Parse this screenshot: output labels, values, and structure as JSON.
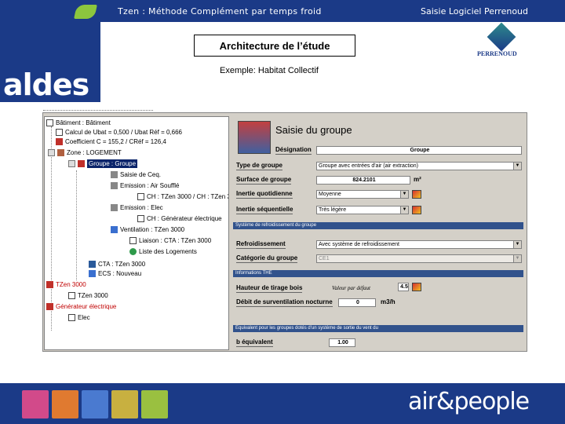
{
  "header": {
    "subtitle": "Tzen : Méthode Complément par temps froid",
    "right_title": "Saisie Logiciel Perrenoud",
    "slide_title": "Architecture de l’étude",
    "example": "Exemple: Habitat Collectif"
  },
  "brand": {
    "left_logo": "aldes",
    "right_logo_name": "PERRENOUD",
    "tagline": "air&people",
    "colors": {
      "navy": "#1b3a87",
      "green": "#8cc63e",
      "window_grey": "#d4d0c8",
      "section_blue": "#31528c"
    }
  },
  "tree": {
    "items": [
      {
        "label": "Bâtiment : Bâtiment",
        "icon": "document-icon"
      },
      {
        "label": "Calcul de Ubat = 0,500 / Ubat Réf = 0,666",
        "icon": "document-icon"
      },
      {
        "label": "Coefficient C = 155,2 / CRéf = 126,4",
        "icon": "c-icon"
      },
      {
        "label": "Zone : LOGEMENT",
        "icon": "house-icon"
      },
      {
        "label": "Groupe : Groupe",
        "icon": "group-icon",
        "selected": true
      },
      {
        "label": "Saisie de Ceq.",
        "icon": "grey-icon"
      },
      {
        "label": "Emission : Air Soufflé",
        "icon": "grey-icon"
      },
      {
        "label": "CH : TZen 3000 / CH : TZen 3",
        "icon": "link-icon"
      },
      {
        "label": "Emission : Elec",
        "icon": "grey-icon"
      },
      {
        "label": "CH : Générateur électrique",
        "icon": "link-icon"
      },
      {
        "label": "Ventilation : TZen 3000",
        "icon": "fan-icon"
      },
      {
        "label": "Liaison : CTA : TZen 3000",
        "icon": "link-icon"
      },
      {
        "label": "Liste des Logements",
        "icon": "list-icon"
      },
      {
        "label": "CTA : TZen 3000",
        "icon": "cta-icon"
      },
      {
        "label": "ECS : Nouveau",
        "icon": "ecs-icon"
      },
      {
        "label": "TZen 3000",
        "icon": "generator-icon",
        "highlight": true
      },
      {
        "label": "TZen 3000",
        "icon": "generator-icon"
      },
      {
        "label": "Générateur électrique",
        "icon": "generator-icon",
        "highlight": true
      },
      {
        "label": "Elec",
        "icon": "generator-icon"
      }
    ]
  },
  "form": {
    "title": "Saisie du groupe",
    "designation_label": "Désignation",
    "designation_value": "Groupe",
    "type_label": "Type de groupe",
    "type_value": "Groupe avec entrées d'air (air extraction)",
    "surface_label": "Surface de groupe",
    "surface_value": "824.2101",
    "surface_unit": "m²",
    "inertie_q_label": "Inertie quotidienne",
    "inertie_q_value": "Moyenne",
    "inertie_s_label": "Inertie séquentielle",
    "inertie_s_value": "Très légère",
    "section1": "Système de refroidissement du groupe",
    "refroid_label": "Refroidissement",
    "refroid_value": "Avec système de refroidissement",
    "categorie_label": "Catégorie du groupe",
    "categorie_value": "CE1",
    "section2": "Informations THE",
    "hauteur_label": "Hauteur de tirage bois",
    "hauteur_note": "Valeur par défaut",
    "hauteur_value": "4.5",
    "debit_label": "Débit de surventilation nocturne",
    "debit_value": "0",
    "debit_unit": "m3/h",
    "section3": "Equivalent pour les groupes dotés d'un système de sortie du vent du",
    "b_label": "b équivalent",
    "b_value": "1.00"
  },
  "faces": [
    "#d24a8a",
    "#e07a30",
    "#4a7ad0",
    "#c8b040",
    "#9ac040"
  ]
}
